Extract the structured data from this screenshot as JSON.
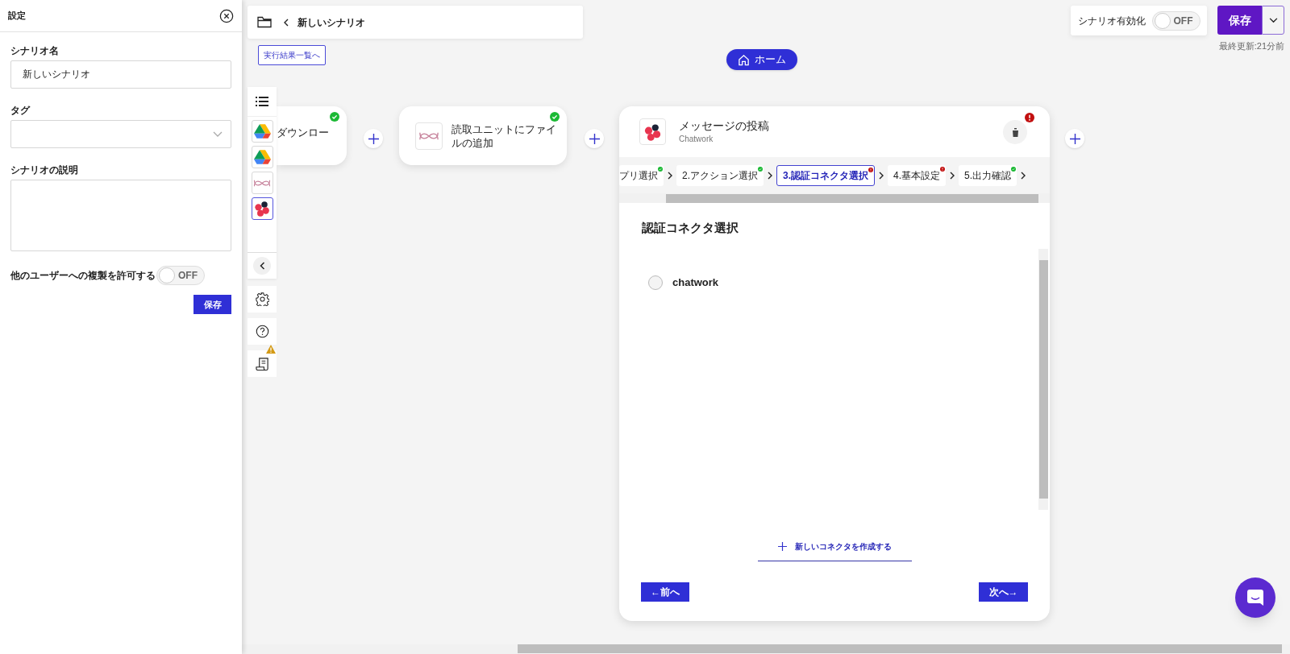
{
  "settings_panel": {
    "title": "設定",
    "fields": [
      {
        "label": "シナリオ名",
        "kind": "text",
        "value": "新しいシナリオ"
      },
      {
        "label": "タグ",
        "kind": "select"
      },
      {
        "label": "シナリオの説明",
        "kind": "textarea"
      }
    ],
    "copy_toggle": {
      "label": "他のユーザーへの複製を許可する",
      "on": false,
      "state_label": "OFF"
    },
    "save_button": "保存"
  },
  "breadcrumb": {
    "title": "新しいシナリオ"
  },
  "results_link": "実行結果一覧へ",
  "home_button": "ホーム",
  "enable_toggle": {
    "label": "シナリオ有効化",
    "on": false,
    "state_label": "OFF"
  },
  "save_button": "保存",
  "last_updated": "最終更新:21分前",
  "toolbar": {
    "apps": [
      {
        "kind": "drive",
        "selected": false
      },
      {
        "kind": "drive",
        "selected": false
      },
      {
        "kind": "reader",
        "selected": false
      },
      {
        "kind": "chatwork",
        "selected": true
      }
    ],
    "log_warning": true
  },
  "nodes": [
    {
      "title": "ダウンロー",
      "completed": true
    },
    {
      "kind": "reader",
      "title": "読取ユニットにファイルの追加",
      "completed": true
    }
  ],
  "main_node": {
    "title": "メッセージの投稿",
    "kind": "chatwork",
    "app_name": "Chatwork",
    "has_error": true,
    "steps": [
      {
        "label": "プリ選択",
        "has_error": false,
        "selected": false
      },
      {
        "label": "2.アクション選択",
        "has_error": false,
        "selected": false
      },
      {
        "label": "3.認証コネクタ選択",
        "has_error": true,
        "selected": true
      },
      {
        "label": "4.基本設定",
        "has_error": true,
        "selected": false
      },
      {
        "label": "5.出力確認",
        "has_error": false,
        "selected": false
      }
    ],
    "section_title": "認証コネクタ選択",
    "connectors": [
      {
        "label": "chatwork",
        "selected": false
      }
    ],
    "new_connector": "新しいコネクタを作成する",
    "prev_button": "←前へ",
    "next_button": "次へ→"
  }
}
